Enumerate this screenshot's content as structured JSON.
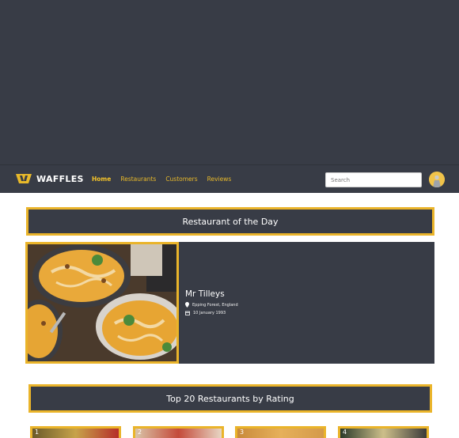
{
  "nav": {
    "brand": "WAFFLES",
    "links": [
      "Home",
      "Restaurants",
      "Customers",
      "Reviews"
    ],
    "active": "Home",
    "search_placeholder": "Search"
  },
  "restaurant_of_the_day": {
    "heading": "Restaurant of the Day",
    "name": "Mr Tilleys",
    "location": "Epping Forest, England",
    "date": "10 January 1993"
  },
  "top_restaurants": {
    "heading": "Top 20 Restaurants by Rating",
    "items": [
      "1",
      "2",
      "3",
      "4"
    ]
  },
  "colors": {
    "accent": "#eab42a",
    "panel": "#383c46",
    "background": "#ffffff"
  }
}
